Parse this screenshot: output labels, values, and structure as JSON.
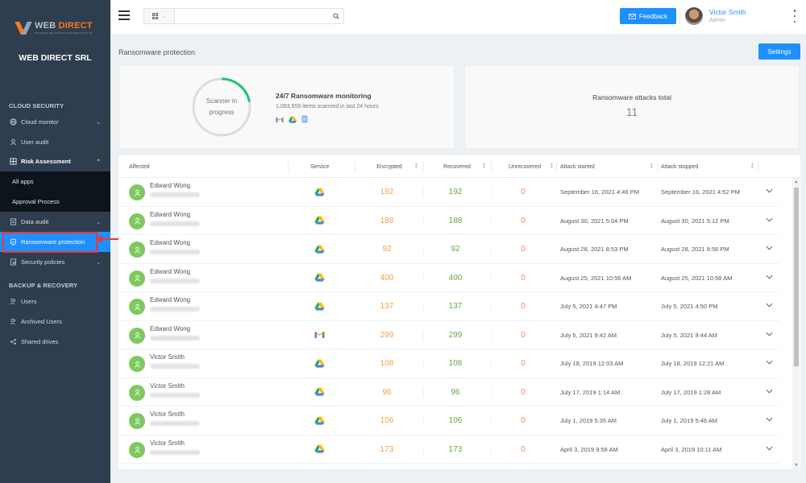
{
  "sidebar": {
    "logo_word1": "WEB",
    "logo_word2": "DIRECT",
    "logo_tagline": "BUSINESS RELATIONSHIP BASED ON TRUST",
    "company": "WEB DIRECT SRL",
    "sections": [
      {
        "title": "CLOUD SECURITY"
      },
      {
        "title": "BACKUP & RECOVERY"
      }
    ],
    "items": [
      {
        "label": "Cloud monitor",
        "icon": "globe-icon",
        "chevron": "down"
      },
      {
        "label": "User audit",
        "icon": "user-icon"
      },
      {
        "label": "Risk Assessment",
        "icon": "grid-icon",
        "chevron": "up",
        "expanded": true
      },
      {
        "label": "Data audit",
        "icon": "document-icon",
        "chevron": "down"
      },
      {
        "label": "Ransomware protection",
        "icon": "shield-icon",
        "active": true
      },
      {
        "label": "Security policies",
        "icon": "policy-icon",
        "chevron": "down"
      },
      {
        "label": "Users",
        "icon": "users-icon"
      },
      {
        "label": "Archived Users",
        "icon": "archived-users-icon"
      },
      {
        "label": "Shared drives",
        "icon": "share-icon"
      }
    ],
    "sub_items": [
      {
        "label": "All apps"
      },
      {
        "label": "Approval Process"
      }
    ]
  },
  "topbar": {
    "search_placeholder": "",
    "search_value": "",
    "feedback_label": "Feedback",
    "user_name": "Victor Smith",
    "user_role": "Admin"
  },
  "page": {
    "title": "Ransomware protection",
    "settings_label": "Settings"
  },
  "scanner": {
    "status_text": "Scanner in progress",
    "status_line1": "Scanner in",
    "status_line2": "progress",
    "progress_fraction": 0.22,
    "accent_color": "#22c47a",
    "monitoring_title": "24/7 Ransomware monitoring",
    "monitoring_subtitle": "1,093,559 items scanned in last 24 hours",
    "services": [
      "gmail-icon",
      "google-drive-icon",
      "google-docs-icon"
    ]
  },
  "totals": {
    "title": "Ransomware attacks total",
    "value": "11"
  },
  "table": {
    "columns": [
      "Affected",
      "Service",
      "Encrypted",
      "Recovered",
      "Unrecovered",
      "Attack started",
      "Attack stopped"
    ],
    "colors": {
      "encrypted": "#f5a14a",
      "recovered": "#6ca745",
      "unrecovered": "#f58560"
    },
    "rows": [
      {
        "name": "Edward Wong",
        "service": "google-drive",
        "encrypted": "192",
        "recovered": "192",
        "unrecovered": "0",
        "started": "September 16, 2021 4:46 PM",
        "stopped": "September 16, 2021 4:52 PM"
      },
      {
        "name": "Edward Wong",
        "service": "google-drive",
        "encrypted": "188",
        "recovered": "188",
        "unrecovered": "0",
        "started": "August 30, 2021 5:04 PM",
        "stopped": "August 30, 2021 5:12 PM"
      },
      {
        "name": "Edward Wong",
        "service": "google-drive",
        "encrypted": "92",
        "recovered": "92",
        "unrecovered": "0",
        "started": "August 28, 2021 8:53 PM",
        "stopped": "August 28, 2021 8:56 PM"
      },
      {
        "name": "Edward Wong",
        "service": "google-drive",
        "encrypted": "400",
        "recovered": "400",
        "unrecovered": "0",
        "started": "August 25, 2021 10:56 AM",
        "stopped": "August 25, 2021 10:58 AM"
      },
      {
        "name": "Edward Wong",
        "service": "google-drive",
        "encrypted": "137",
        "recovered": "137",
        "unrecovered": "0",
        "started": "July 5, 2021 4:47 PM",
        "stopped": "July 5, 2021 4:50 PM"
      },
      {
        "name": "Edward Wong",
        "service": "gmail",
        "encrypted": "299",
        "recovered": "299",
        "unrecovered": "0",
        "started": "July 5, 2021 9:42 AM",
        "stopped": "July 5, 2021 9:44 AM"
      },
      {
        "name": "Victor Smith",
        "service": "google-drive",
        "encrypted": "108",
        "recovered": "108",
        "unrecovered": "0",
        "started": "July 18, 2019 12:03 AM",
        "stopped": "July 18, 2019 12:21 AM"
      },
      {
        "name": "Victor Smith",
        "service": "google-drive",
        "encrypted": "96",
        "recovered": "96",
        "unrecovered": "0",
        "started": "July 17, 2019 1:14 AM",
        "stopped": "July 17, 2019 1:28 AM"
      },
      {
        "name": "Victor Smith",
        "service": "google-drive",
        "encrypted": "106",
        "recovered": "106",
        "unrecovered": "0",
        "started": "July 1, 2019 5:35 AM",
        "stopped": "July 1, 2019 5:46 AM"
      },
      {
        "name": "Victor Smith",
        "service": "google-drive",
        "encrypted": "173",
        "recovered": "173",
        "unrecovered": "0",
        "started": "April 3, 2019 9:58 AM",
        "stopped": "April 3, 2019 10:11 AM"
      }
    ]
  }
}
